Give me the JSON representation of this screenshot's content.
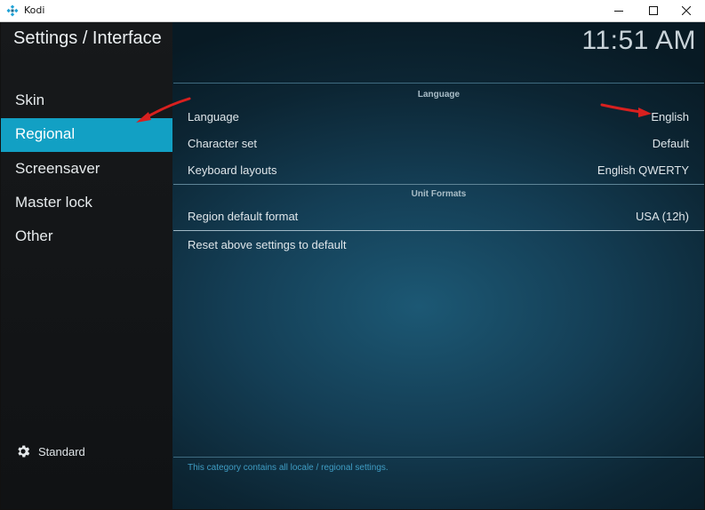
{
  "window": {
    "title": "Kodi",
    "icon": "kodi-logo-icon",
    "controls": [
      "minimize-icon",
      "maximize-icon",
      "close-icon"
    ]
  },
  "header": {
    "title": "Settings / Interface",
    "clock": "11:51 AM"
  },
  "sidebar": {
    "items": [
      {
        "label": "Skin",
        "active": false
      },
      {
        "label": "Regional",
        "active": true
      },
      {
        "label": "Screensaver",
        "active": false
      },
      {
        "label": "Master lock",
        "active": false
      },
      {
        "label": "Other",
        "active": false
      }
    ],
    "settings_level": {
      "icon": "gear-icon",
      "label": "Standard"
    }
  },
  "sections": [
    {
      "header": "Language",
      "rows": [
        {
          "label": "Language",
          "value": "English"
        },
        {
          "label": "Character set",
          "value": "Default"
        },
        {
          "label": "Keyboard layouts",
          "value": "English QWERTY"
        }
      ]
    },
    {
      "header": "Unit Formats",
      "rows": [
        {
          "label": "Region default format",
          "value": "USA (12h)"
        }
      ]
    }
  ],
  "reset": {
    "label": "Reset above settings to default"
  },
  "footer": {
    "description": "This category contains all locale / regional settings."
  },
  "colors": {
    "accent": "#12a0c4",
    "annotation_arrow": "#d8201f",
    "footer_text": "#3f9dc4"
  }
}
